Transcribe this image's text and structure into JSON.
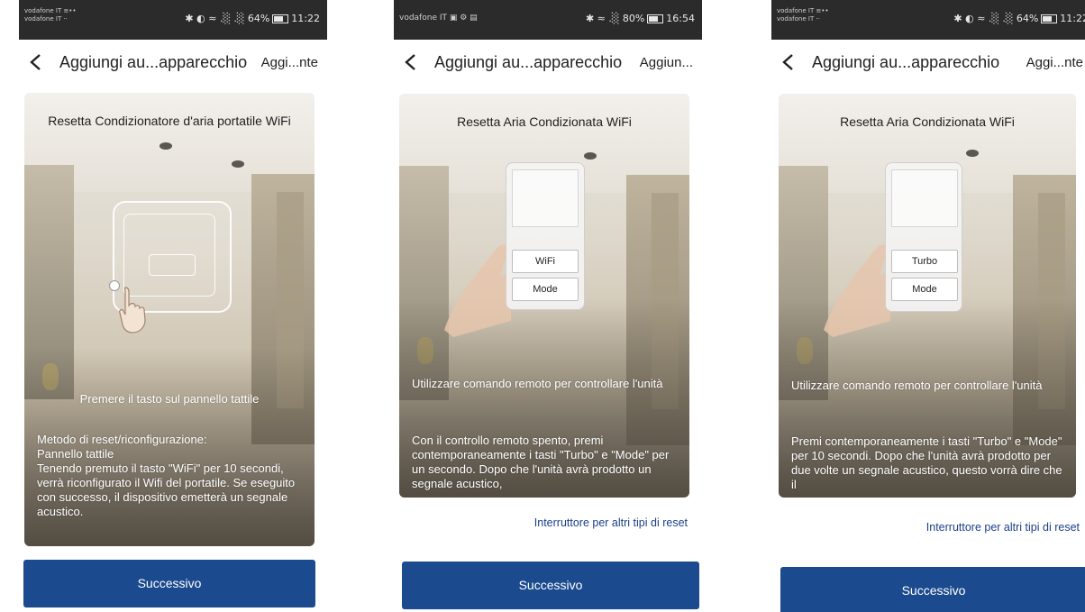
{
  "screens": [
    {
      "status": {
        "carrier": "vodafone IT ≡••\nvodafone IT ··",
        "right": "✱ ◐ ≈ .░ .░ 64%",
        "time": "11:22"
      },
      "nav": {
        "back_icon": "chevron-left-icon",
        "title": "Aggiungi au...apparecchio",
        "action": "Aggi...nte"
      },
      "card": {
        "title": "Resetta Condizionatore d'aria portatile WiFi",
        "instruction": "Premere il tasto sul pannello tattile",
        "body": "Metodo di reset/riconfigurazione:\nPannello tattile\nTenendo premuto il tasto \"WiFi\" per 10 secondi, verrà riconfigurato il Wifi del portatile. Se eseguito con successo, il dispositivo emetterà un segnale acustico."
      },
      "next_button": "Successivo"
    },
    {
      "status": {
        "carrier": "vodafone IT ▣ ⚙ ▤",
        "right": "✱ ≈ .░ 80%",
        "time": "16:54"
      },
      "nav": {
        "back_icon": "chevron-left-icon",
        "title": "Aggiungi au...apparecchio",
        "action": "Aggiun..."
      },
      "card": {
        "title": "Resetta Aria Condizionata WiFi",
        "remote_buttons": [
          "WiFi",
          "Mode"
        ],
        "instruction": "Utilizzare comando remoto per controllare l'unità",
        "body": "Con il controllo remoto spento, premi contemporaneamente i tasti \"Turbo\" e \"Mode\" per un secondo. Dopo che l'unità avrà prodotto un segnale acustico,"
      },
      "switch_link": "Interruttore per altri tipi di reset",
      "next_button": "Successivo"
    },
    {
      "status": {
        "carrier": "vodafone IT ≡••\nvodafone IT ··",
        "right": "✱ ◐ ≈ .░ .░ 64%",
        "time": "11:22"
      },
      "nav": {
        "back_icon": "chevron-left-icon",
        "title": "Aggiungi au...apparecchio",
        "action": "Aggi...nte"
      },
      "card": {
        "title": "Resetta Aria Condizionata WiFi",
        "remote_buttons": [
          "Turbo",
          "Mode"
        ],
        "instruction": "Utilizzare comando remoto per controllare l'unità",
        "body": "Premi contemporaneamente i tasti \"Turbo\" e \"Mode\" per 10 secondi. Dopo che l'unità avrà prodotto per due volte un segnale acustico, questo vorrà dire che il"
      },
      "switch_link": "Interruttore per altri tipi di reset",
      "next_button": "Successivo"
    }
  ],
  "colors": {
    "primary": "#1b4a8e",
    "link": "#1c3f8a",
    "statusbar": "#2b2b2b"
  }
}
